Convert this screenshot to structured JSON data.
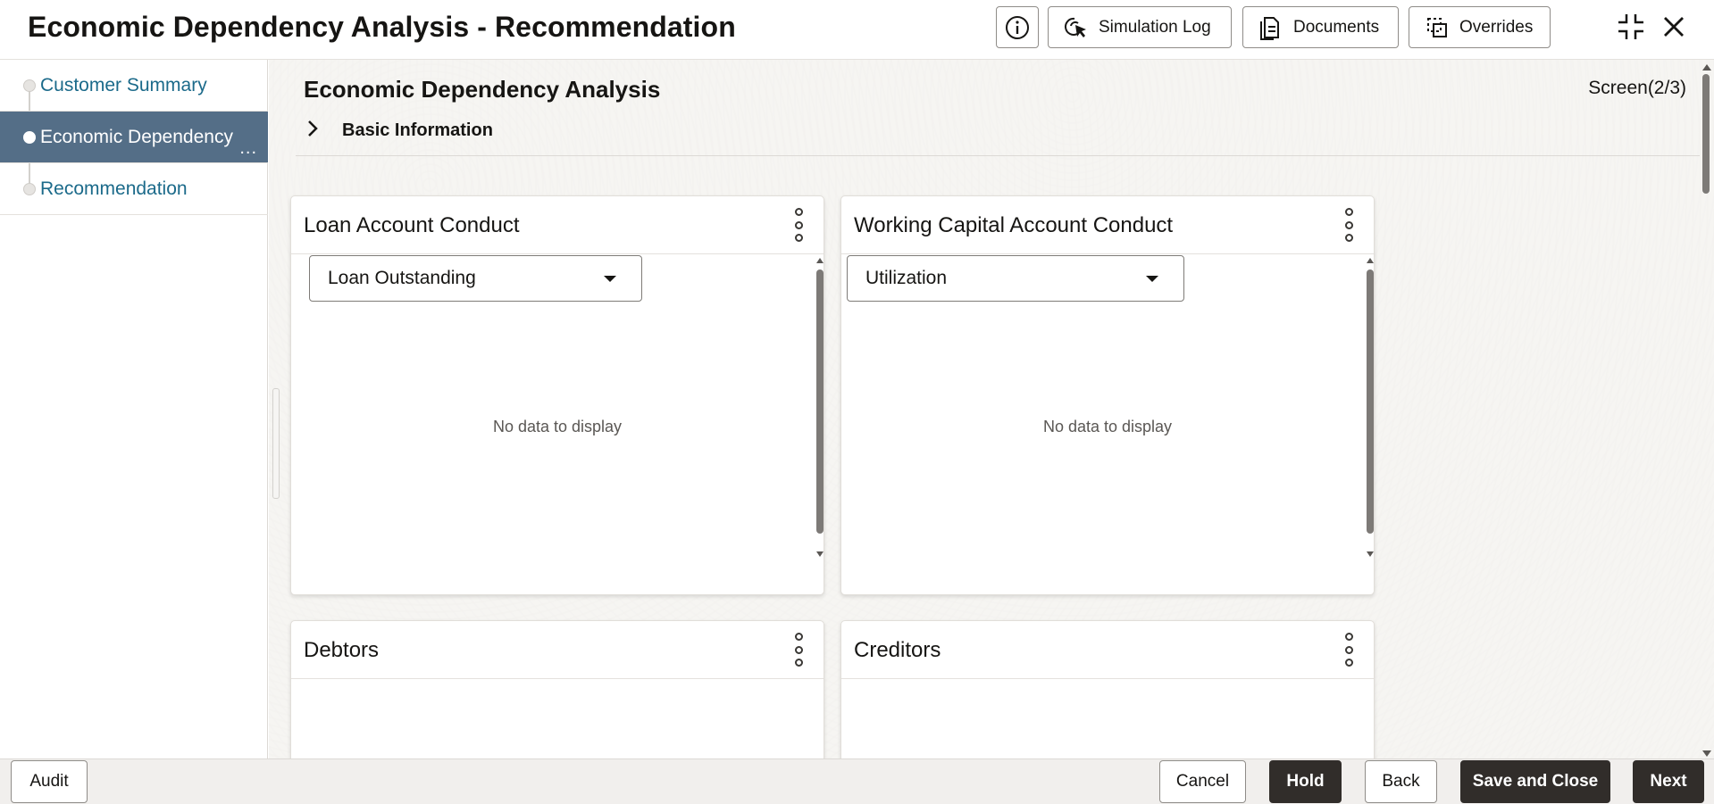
{
  "header": {
    "title": "Economic Dependency Analysis - Recommendation",
    "buttons": {
      "simulation_log": "Simulation Log",
      "documents": "Documents",
      "overrides": "Overrides"
    }
  },
  "sidebar": {
    "items": [
      {
        "label": "Customer Summary",
        "active": false
      },
      {
        "label": "Economic Dependency",
        "active": true,
        "ellipsis": "..."
      },
      {
        "label": "Recommendation",
        "active": false
      }
    ]
  },
  "main": {
    "title": "Economic Dependency Analysis",
    "screen_indicator": "Screen(2/3)",
    "basic_information": "Basic Information",
    "cards": [
      {
        "title": "Loan Account Conduct",
        "select_value": "Loan Outstanding",
        "empty_text": "No data to display"
      },
      {
        "title": "Working Capital Account Conduct",
        "select_value": "Utilization",
        "empty_text": "No data to display"
      },
      {
        "title": "Debtors"
      },
      {
        "title": "Creditors"
      }
    ]
  },
  "footer": {
    "audit": "Audit",
    "cancel": "Cancel",
    "hold": "Hold",
    "back": "Back",
    "save_and_close": "Save and Close",
    "next": "Next"
  },
  "colors": {
    "sidebar_active": "#546e87",
    "link": "#1b6a8a",
    "solid_button": "#312d2a"
  }
}
